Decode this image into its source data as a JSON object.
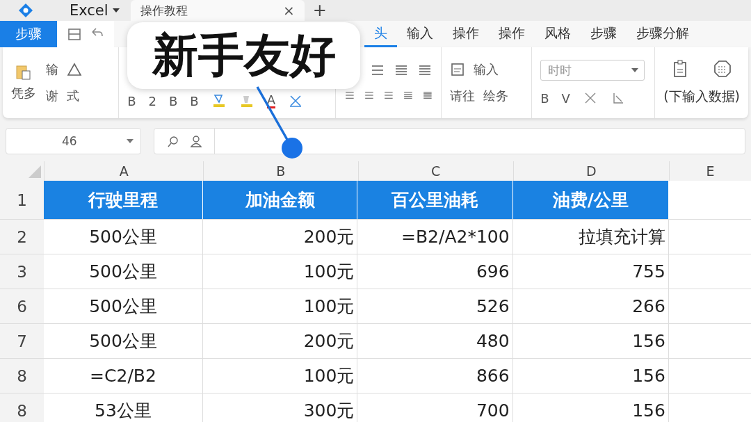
{
  "app": {
    "name": "Excel",
    "doc_tab": "操作教程",
    "close": "×",
    "new_tab": "+"
  },
  "ribbon": {
    "file_button": "步骤",
    "tabs": [
      {
        "label": "头",
        "selected": true
      },
      {
        "label": "输入",
        "selected": false
      },
      {
        "label": "操作",
        "selected": false
      },
      {
        "label": "操作",
        "selected": false
      },
      {
        "label": "风格",
        "selected": false
      },
      {
        "label": "步骤",
        "selected": false
      },
      {
        "label": "步骤分解",
        "selected": false
      }
    ],
    "clipboard": {
      "paste": "凭多",
      "top": "输",
      "bottom": [
        "谢",
        "式"
      ]
    },
    "font": {
      "buttons": [
        "B",
        "2",
        "B",
        "B"
      ],
      "color_label": "A"
    },
    "cells": {
      "wrap": "请往",
      "insert": "输入",
      "format": "绘务"
    },
    "number": {
      "format_placeholder": "时时",
      "buttons": [
        "B",
        "V"
      ]
    },
    "data": {
      "label": "(下输入数据)"
    }
  },
  "formula_bar": {
    "name_box": "46"
  },
  "callout": {
    "text": "新手友好"
  },
  "sheet": {
    "columns": [
      "A",
      "B",
      "C",
      "D",
      "E"
    ],
    "rows": [
      {
        "number": "1",
        "kind": "header",
        "cells": [
          "行驶里程",
          "加油金额",
          "百公里油耗",
          "油费/公里"
        ]
      },
      {
        "number": "2",
        "kind": "data",
        "cells": [
          "500公里",
          "200元",
          "=B2/A2*100",
          "拉填充计算"
        ]
      },
      {
        "number": "3",
        "kind": "data",
        "cells": [
          "500公里",
          "100元",
          "696",
          "755"
        ]
      },
      {
        "number": "6",
        "kind": "data",
        "cells": [
          "500公里",
          "100元",
          "526",
          "266"
        ]
      },
      {
        "number": "7",
        "kind": "data",
        "cells": [
          "500公里",
          "200元",
          "480",
          "156"
        ]
      },
      {
        "number": "8",
        "kind": "data",
        "cells": [
          "=C2/B2",
          "100元",
          "866",
          "156"
        ]
      },
      {
        "number": "8",
        "kind": "data",
        "cells": [
          "53公里",
          "300元",
          "700",
          "156"
        ]
      }
    ]
  }
}
